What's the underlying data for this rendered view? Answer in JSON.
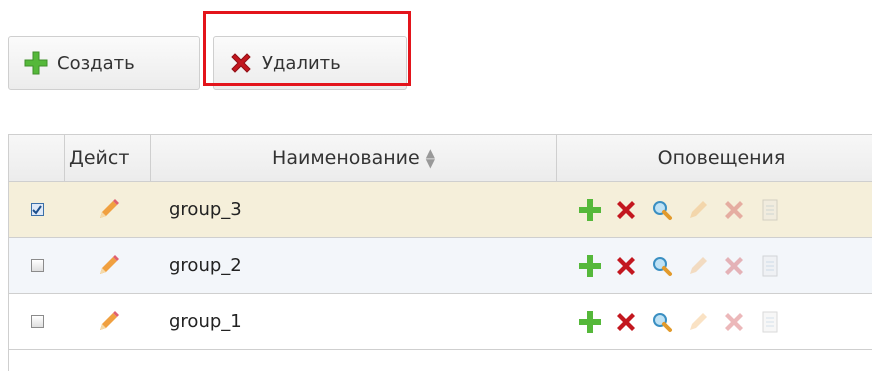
{
  "toolbar": {
    "create_label": "Создать",
    "delete_label": "Удалить"
  },
  "grid": {
    "columns": [
      "Дейст",
      "Наименование",
      "Оповещения"
    ],
    "rows": [
      {
        "checked": true,
        "name": "group_3"
      },
      {
        "checked": false,
        "name": "group_2"
      },
      {
        "checked": false,
        "name": "group_1"
      }
    ]
  },
  "icons": {
    "create": "plus-icon",
    "delete": "x-icon",
    "edit": "pencil-icon",
    "sort": "sort-icon",
    "row_actions": [
      "plus-icon",
      "delete-icon",
      "search-icon",
      "edit-icon",
      "delete-icon",
      "report-icon"
    ]
  },
  "colors": {
    "selected_row": "#f5efda",
    "alt_row": "#f3f6fa",
    "highlight": "#e3141b",
    "plus": "#55b83a",
    "delete": "#c3171f"
  }
}
